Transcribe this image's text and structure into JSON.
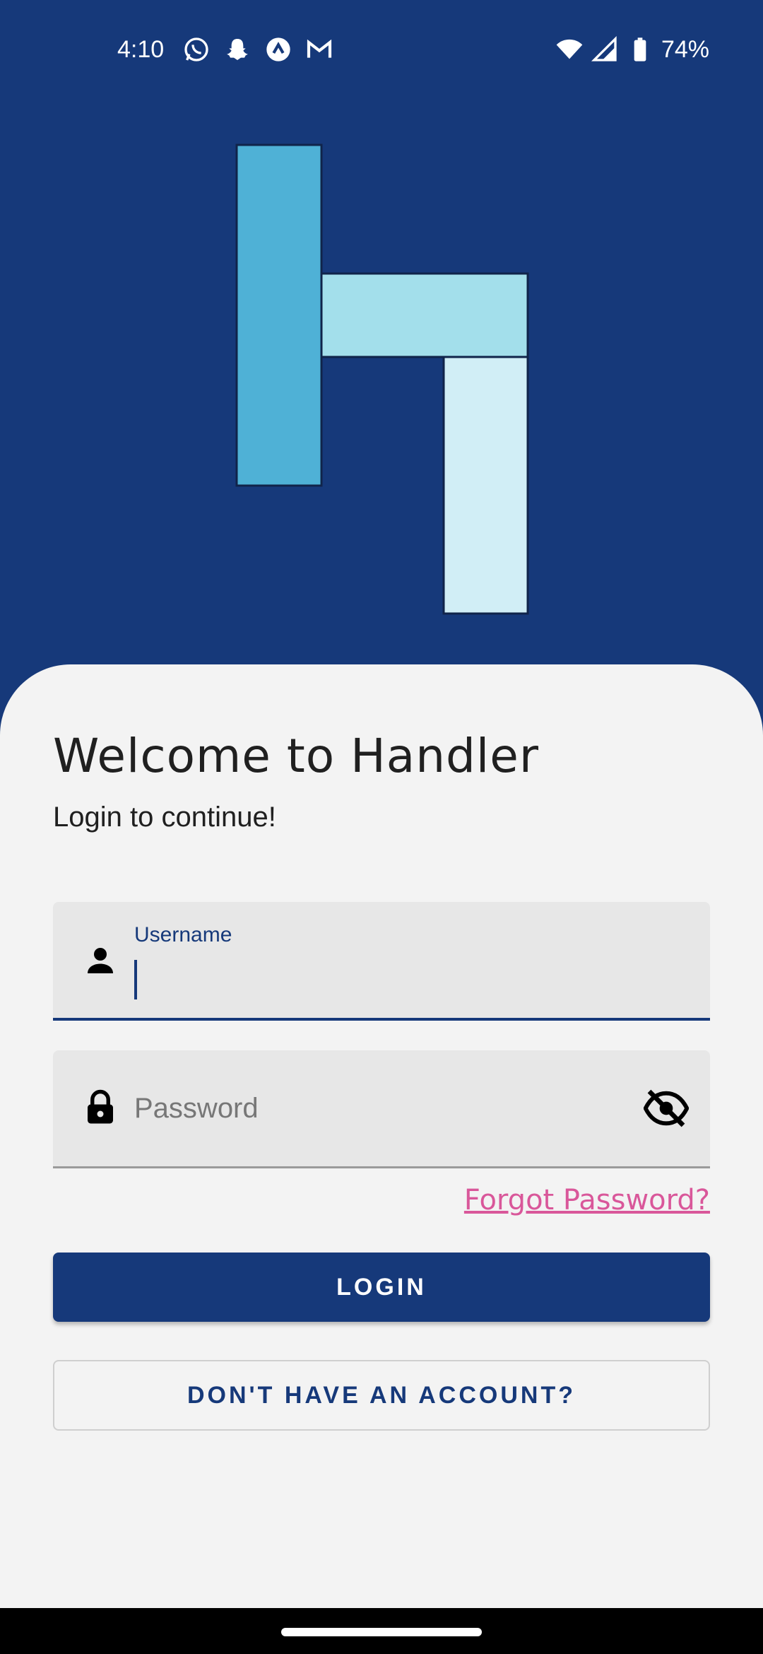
{
  "status_bar": {
    "time": "4:10",
    "battery": "74%",
    "notification_icons": [
      "whatsapp-icon",
      "snapchat-icon",
      "app-arrow-icon",
      "gmail-icon"
    ]
  },
  "logo": {
    "colors": [
      "#4fb1d6",
      "#a3dfeb",
      "#d1eef6"
    ]
  },
  "welcome": {
    "title": "Welcome to Handler",
    "subtitle": "Login to continue!"
  },
  "form": {
    "username": {
      "label": "Username",
      "value": ""
    },
    "password": {
      "placeholder": "Password",
      "value": ""
    },
    "forgot_password": "Forgot Password?",
    "login_button": "LOGIN",
    "signup_button": "DON'T HAVE AN ACCOUNT?"
  },
  "colors": {
    "primary": "#16397a",
    "background": "#f3f3f3",
    "link": "#d9579a"
  }
}
